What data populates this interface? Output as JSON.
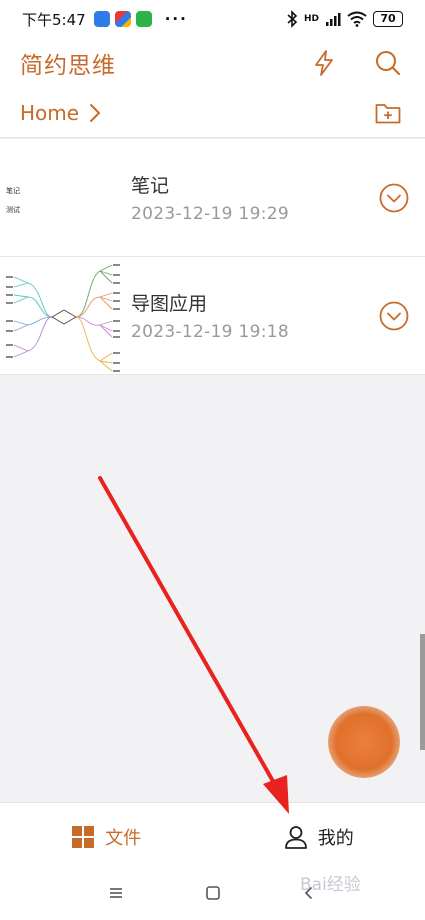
{
  "status_bar": {
    "time": "下午5:47",
    "icons": [
      "bluetooth-app-icon",
      "multicolor-app-icon",
      "green-app-icon"
    ],
    "more": "···",
    "network": "HD",
    "battery": "70"
  },
  "header": {
    "title": "简约思维",
    "actions": [
      "lightning-icon",
      "search-icon"
    ]
  },
  "breadcrumb": {
    "current": "Home"
  },
  "files": [
    {
      "name": "笔记",
      "date": "2023-12-19 19:29",
      "thumb_lines": [
        "笔记",
        "测试"
      ]
    },
    {
      "name": "导图应用",
      "date": "2023-12-19 19:18"
    }
  ],
  "bottom_nav": {
    "tabs": [
      {
        "label": "文件",
        "icon": "grid-icon",
        "active": true
      },
      {
        "label": "我的",
        "icon": "person-icon",
        "active": false
      }
    ]
  },
  "watermark": "Bai经验",
  "colors": {
    "accent": "#c86b2a",
    "fab": "#e0712b",
    "arrow": "#e8221f"
  }
}
